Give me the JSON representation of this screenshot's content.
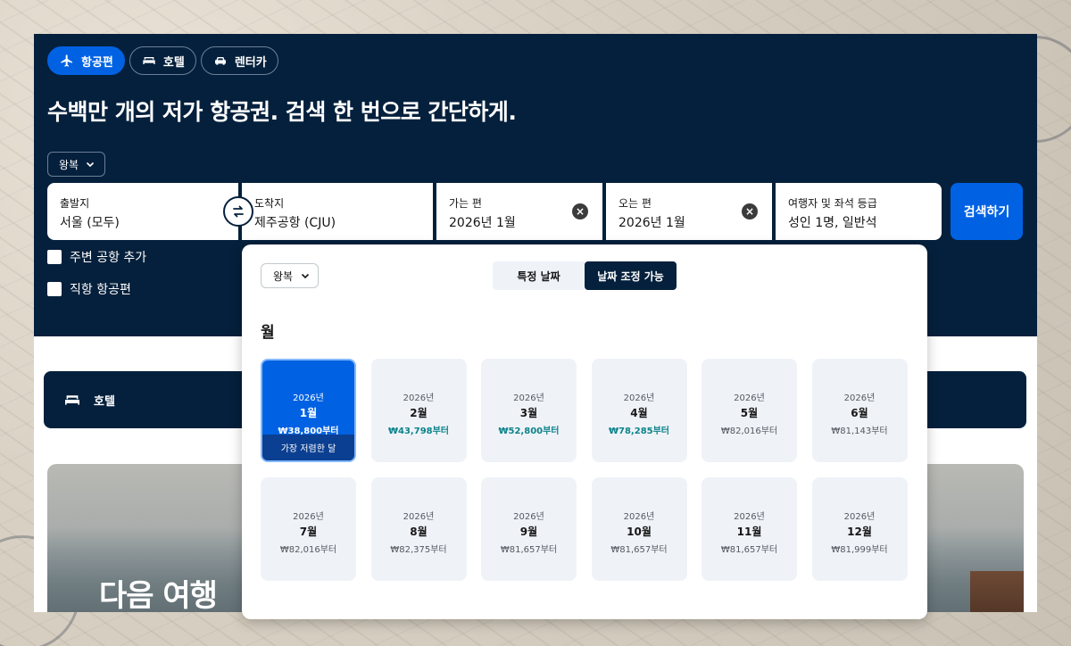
{
  "tabs": [
    {
      "label": "항공편",
      "icon": "plane-icon",
      "active": true
    },
    {
      "label": "호텔",
      "icon": "bed-icon",
      "active": false
    },
    {
      "label": "렌터카",
      "icon": "car-icon",
      "active": false
    }
  ],
  "headline": "수백만 개의 저가 항공권. 검색 한 번으로 간단하게.",
  "trip_type": "왕복",
  "fields": {
    "origin": {
      "label": "출발지",
      "value": "서울 (모두)"
    },
    "destination": {
      "label": "도착지",
      "value": "제주공항 (CJU)"
    },
    "depart": {
      "label": "가는 편",
      "value": "2026년 1월"
    },
    "return": {
      "label": "오는 편",
      "value": "2026년 1월"
    },
    "travellers": {
      "label": "여행자 및 좌석 등급",
      "value": "성인 1명, 일반석"
    }
  },
  "search_label": "검색하기",
  "checkboxes": {
    "nearby": "주변 공항 추가",
    "direct": "직항 항공편"
  },
  "hotel_bar_label": "호텔",
  "photo_text": "다음 여행",
  "popup": {
    "trip_type": "왕복",
    "segment": {
      "specific": "특정 날짜",
      "flexible": "날짜 조정 가능",
      "active": "flexible"
    },
    "month_title": "월",
    "cheapest_label": "가장 저렴한 달",
    "months": [
      {
        "year": "2026년",
        "month": "1월",
        "price": "₩38,800부터",
        "selected": true,
        "highlight": false
      },
      {
        "year": "2026년",
        "month": "2월",
        "price": "₩43,798부터",
        "selected": false,
        "highlight": true
      },
      {
        "year": "2026년",
        "month": "3월",
        "price": "₩52,800부터",
        "selected": false,
        "highlight": true
      },
      {
        "year": "2026년",
        "month": "4월",
        "price": "₩78,285부터",
        "selected": false,
        "highlight": true
      },
      {
        "year": "2026년",
        "month": "5월",
        "price": "₩82,016부터",
        "selected": false,
        "highlight": false
      },
      {
        "year": "2026년",
        "month": "6월",
        "price": "₩81,143부터",
        "selected": false,
        "highlight": false
      },
      {
        "year": "2026년",
        "month": "7월",
        "price": "₩82,016부터",
        "selected": false,
        "highlight": false
      },
      {
        "year": "2026년",
        "month": "8월",
        "price": "₩82,375부터",
        "selected": false,
        "highlight": false
      },
      {
        "year": "2026년",
        "month": "9월",
        "price": "₩81,657부터",
        "selected": false,
        "highlight": false
      },
      {
        "year": "2026년",
        "month": "10월",
        "price": "₩81,657부터",
        "selected": false,
        "highlight": false
      },
      {
        "year": "2026년",
        "month": "11월",
        "price": "₩81,657부터",
        "selected": false,
        "highlight": false
      },
      {
        "year": "2026년",
        "month": "12월",
        "price": "₩81,999부터",
        "selected": false,
        "highlight": false
      }
    ]
  },
  "colors": {
    "navy": "#05203c",
    "blue": "#0062e3",
    "green_price": "#0c838a"
  }
}
